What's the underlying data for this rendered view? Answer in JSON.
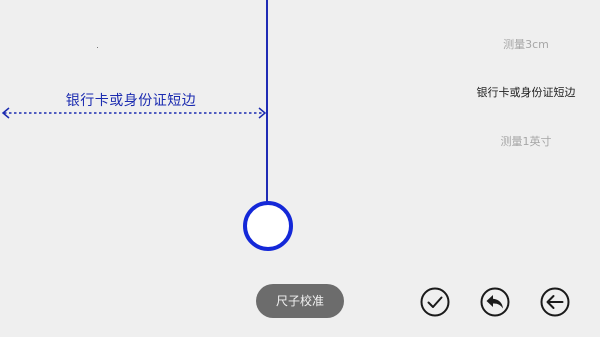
{
  "ruler": {
    "measure_label": "银行卡或身份证短边",
    "line_color": "#1f2bb5",
    "handle_color": "#1428d8"
  },
  "options": {
    "items": [
      {
        "label": "测量3cm",
        "selected": false
      },
      {
        "label": "银行卡或身份证短边",
        "selected": true
      },
      {
        "label": "测量1英寸",
        "selected": false
      }
    ]
  },
  "actions": {
    "calibrate_label": "尺子校准",
    "confirm_icon": "check-circle-icon",
    "undo_icon": "undo-arrow-icon",
    "back_icon": "back-arrow-icon"
  },
  "colors": {
    "background": "#efefef",
    "accent": "#1f2bb5",
    "pill_bg": "#6c6c6c"
  }
}
